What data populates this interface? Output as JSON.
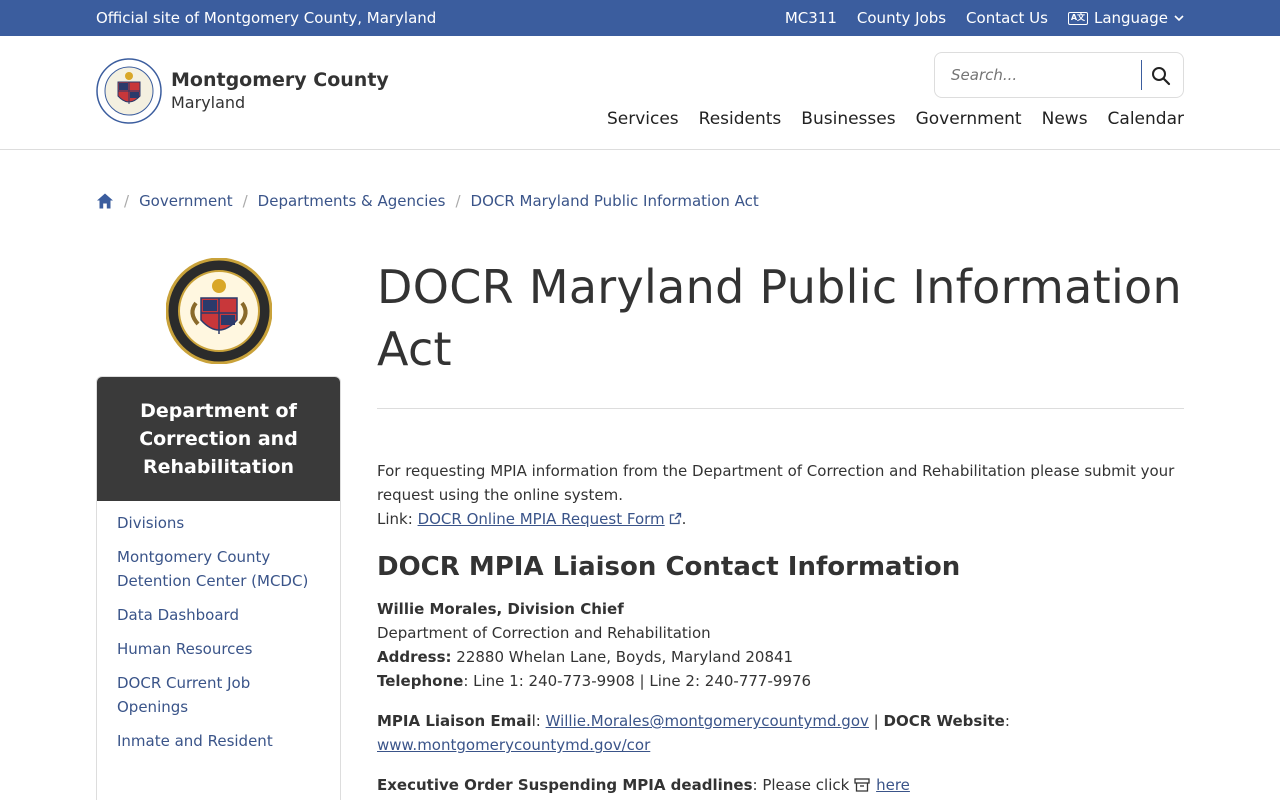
{
  "topbar": {
    "official": "Official site of Montgomery County, Maryland",
    "links": [
      "MC311",
      "County Jobs",
      "Contact Us"
    ],
    "language": "Language"
  },
  "header": {
    "logo_title": "Montgomery County",
    "logo_sub": "Maryland",
    "search_placeholder": "Search...",
    "nav": [
      "Services",
      "Residents",
      "Businesses",
      "Government",
      "News",
      "Calendar"
    ]
  },
  "breadcrumb": [
    "Government",
    "Departments & Agencies",
    "DOCR Maryland Public Information Act"
  ],
  "sidebar": {
    "title": "Department of Correction and Rehabilitation",
    "items": [
      "Divisions",
      "Montgomery County Detention Center (MCDC)",
      "Data Dashboard",
      "Human Resources",
      "DOCR Current Job Openings",
      "Inmate and Resident"
    ]
  },
  "main": {
    "title": "DOCR Maryland Public Information Act",
    "intro": "For requesting MPIA information from the Department of Correction and Rehabilitation please submit your request using the online system.",
    "link_label": "Link:",
    "link_text": "DOCR Online MPIA Request Form",
    "contact_heading": "DOCR MPIA Liaison Contact Information",
    "contact_name": "Willie Morales, Division Chief",
    "contact_dept": "Department of Correction and Rehabilitation",
    "address_label": "Address:",
    "address": "22880 Whelan Lane, Boyds, Maryland 20841",
    "telephone_label": "Telephone",
    "telephone": ": Line 1: 240-773-9908 | Line 2: 240-777-9976",
    "email_label": "MPIA Liaison Emai",
    "email_suffix": "l:",
    "email": "Willie.Morales@montgomerycountymd.gov",
    "website_label": "DOCR Website",
    "website": "www.montgomerycountymd.gov/cor",
    "exec_label": "Executive Order Suspending MPIA deadlines",
    "exec_text": ": Please click",
    "exec_link": "here"
  },
  "colors": {
    "topbar": "#3b5d9e",
    "link": "#3a5489",
    "sidebar_head": "#3a3a3a"
  }
}
